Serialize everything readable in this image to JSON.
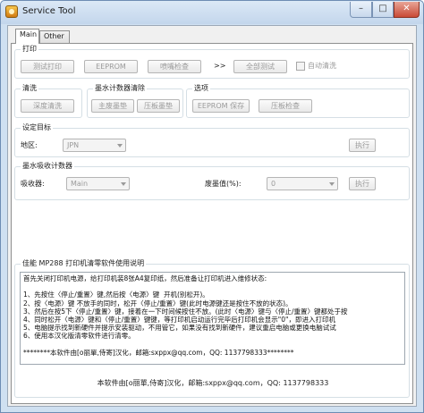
{
  "window": {
    "title": "Service Tool",
    "min": "–",
    "max": "□",
    "close": "✕"
  },
  "tabs": [
    {
      "label": "Main"
    },
    {
      "label": "Other"
    }
  ],
  "print": {
    "title": "打印",
    "buttons": [
      "测试打印",
      "EEPROM",
      "喷嘴检查",
      "全部测试"
    ],
    "arrow": ">>",
    "auto_clean": "自动清洗"
  },
  "clean": {
    "title": "清洗",
    "deep": "深度清洗"
  },
  "ink_counter": {
    "title": "墨水计数器清除",
    "main": "主废墨垫",
    "platen": "压板墨垫"
  },
  "options": {
    "title": "选项",
    "save": "EEPROM 保存",
    "platen_check": "压板检查"
  },
  "target": {
    "title": "设定目标",
    "region_label": "地区:",
    "region_value": "JPN",
    "execute": "执行"
  },
  "absorber": {
    "title": "墨水吸收计数器",
    "absorber_label": "吸收器:",
    "absorber_value": "Main",
    "waste_label": "废墨值(%):",
    "waste_value": "0",
    "execute": "执行"
  },
  "description": {
    "title": "佳能 MP288 打印机清零软件使用说明",
    "text": "首先关闭打印机电源，给打印机装8张A4复印纸，然后准备让打印机进入维修状态:\n\n1、先按住〈停止/重置〉键,然后按〈电源〉键  开机(别松开)。\n2、按〈电源〉键 不放手的同时，松开〈停止/重置〉键(此时电源键还是按住不放的状态)。\n3、然后在按5下〈停止/重置〉键，接着在一下时间候按住不放。(此时〈电源〉键与〈停止/重置〉键都处于按\n4、同时松开〈电源〉键和〈停止/重置〉键键，等打印机启动运行完毕后打印机会显示\"0\"，即进入打印机\n5、电脑提示找到新硬件并提示安装驱动，不用管它，如果没有找到新硬件，建议重启电脑或更换电脑试试\n6、使用本汉化版清零软件进行清零。\n\n********本软件由[o丽單,侍寄]汉化，邮箱:sxppx@qq.com，QQ: 1137798333********",
    "footer": "本软件由[o丽單,侍寄]汉化，邮箱:sxppx@qq.com，QQ: 1137798333"
  }
}
